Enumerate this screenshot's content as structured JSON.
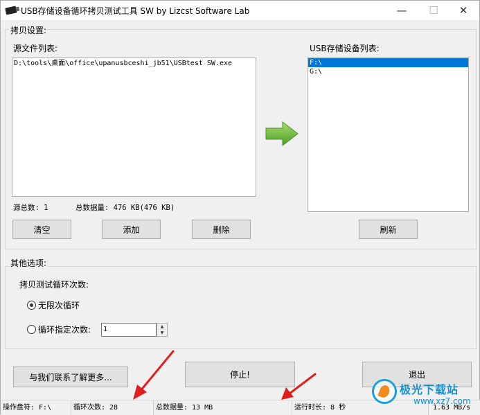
{
  "window": {
    "title": "USB存储设备循环拷贝测试工具 SW  by Lizcst Software Lab",
    "min_glyph": "—",
    "max_glyph": "☐",
    "close_glyph": "✕"
  },
  "copy_settings": {
    "group_title": "拷贝设置:",
    "source_label": "源文件列表:",
    "source_files": [
      "D:\\tools\\桌面\\office\\upanusbceshi_jb51\\USBtest SW.exe"
    ],
    "source_count_label": "源总数: 1",
    "total_data_label": "总数据量: 476 KB(476 KB)",
    "clear_button": "清空",
    "add_button": "添加",
    "delete_button": "删除",
    "device_label": "USB存储设备列表:",
    "devices": [
      {
        "name": "F:\\",
        "selected": true
      },
      {
        "name": "G:\\",
        "selected": false
      }
    ],
    "refresh_button": "刷新",
    "arrow_icon": "green-right-arrow-icon",
    "arrow_color": "#6cbf3c"
  },
  "other_options": {
    "group_title": "其他选项:",
    "loop_label": "拷贝测试循环次数:",
    "radio_infinite": "无限次循环",
    "radio_infinite_checked": true,
    "radio_count": "循环指定次数:",
    "radio_count_checked": false,
    "count_value": "1"
  },
  "actions": {
    "contact_button": "与我们联系了解更多...",
    "stop_button": "停止!",
    "exit_button": "退出"
  },
  "statusbar": {
    "drive": "操作盘符: F:\\",
    "loop_count": "循环次数: 28",
    "total_data": "总数据量: 13 MB",
    "run_time": "运行时长: 8 秒",
    "speed": "1.63 MB/s"
  },
  "watermark": {
    "text_cn": "极光下载站",
    "text_url": "www.xz7.com"
  },
  "colors": {
    "selection": "#0078d7",
    "annotation_arrow": "#e0201e"
  }
}
